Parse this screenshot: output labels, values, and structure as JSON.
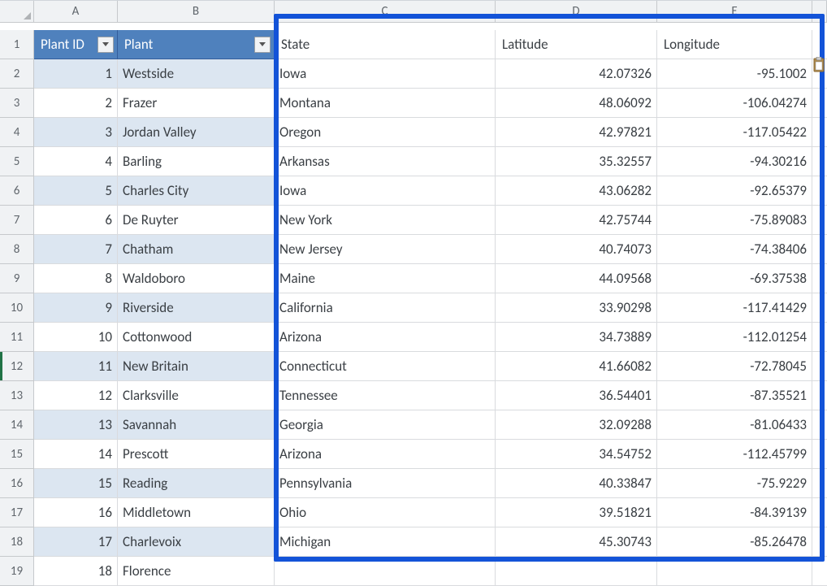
{
  "columns": {
    "A": "A",
    "B": "B",
    "C": "C",
    "D": "D",
    "E": "E"
  },
  "table_headers": {
    "plant_id": "Plant ID",
    "plant": "Plant"
  },
  "plain_headers": {
    "state": "State",
    "latitude": "Latitude",
    "longitude": "Longitude"
  },
  "rows": [
    {
      "n": "1"
    },
    {
      "n": "2",
      "id": "1",
      "plant": "Westside",
      "state": "Iowa",
      "lat": "42.07326",
      "lon": "-95.1002"
    },
    {
      "n": "3",
      "id": "2",
      "plant": "Frazer",
      "state": "Montana",
      "lat": "48.06092",
      "lon": "-106.04274"
    },
    {
      "n": "4",
      "id": "3",
      "plant": "Jordan Valley",
      "state": "Oregon",
      "lat": "42.97821",
      "lon": "-117.05422"
    },
    {
      "n": "5",
      "id": "4",
      "plant": "Barling",
      "state": "Arkansas",
      "lat": "35.32557",
      "lon": "-94.30216"
    },
    {
      "n": "6",
      "id": "5",
      "plant": "Charles City",
      "state": "Iowa",
      "lat": "43.06282",
      "lon": "-92.65379"
    },
    {
      "n": "7",
      "id": "6",
      "plant": "De Ruyter",
      "state": "New York",
      "lat": "42.75744",
      "lon": "-75.89083"
    },
    {
      "n": "8",
      "id": "7",
      "plant": "Chatham",
      "state": "New Jersey",
      "lat": "40.74073",
      "lon": "-74.38406"
    },
    {
      "n": "9",
      "id": "8",
      "plant": "Waldoboro",
      "state": "Maine",
      "lat": "44.09568",
      "lon": "-69.37538"
    },
    {
      "n": "10",
      "id": "9",
      "plant": "Riverside",
      "state": "California",
      "lat": "33.90298",
      "lon": "-117.41429"
    },
    {
      "n": "11",
      "id": "10",
      "plant": "Cottonwood",
      "state": "Arizona",
      "lat": "34.73889",
      "lon": "-112.01254"
    },
    {
      "n": "12",
      "id": "11",
      "plant": "New Britain",
      "state": "Connecticut",
      "lat": "41.66082",
      "lon": "-72.78045"
    },
    {
      "n": "13",
      "id": "12",
      "plant": "Clarksville",
      "state": "Tennessee",
      "lat": "36.54401",
      "lon": "-87.35521"
    },
    {
      "n": "14",
      "id": "13",
      "plant": "Savannah",
      "state": "Georgia",
      "lat": "32.09288",
      "lon": "-81.06433"
    },
    {
      "n": "15",
      "id": "14",
      "plant": "Prescott",
      "state": "Arizona",
      "lat": "34.54752",
      "lon": "-112.45799"
    },
    {
      "n": "16",
      "id": "15",
      "plant": "Reading",
      "state": "Pennsylvania",
      "lat": "40.33847",
      "lon": "-75.9229"
    },
    {
      "n": "17",
      "id": "16",
      "plant": "Middletown",
      "state": "Ohio",
      "lat": "39.51821",
      "lon": "-84.39139"
    },
    {
      "n": "18",
      "id": "17",
      "plant": "Charlevoix",
      "state": "Michigan",
      "lat": "45.30743",
      "lon": "-85.26478"
    },
    {
      "n": "19",
      "id": "18",
      "plant": "Florence",
      "state": "",
      "lat": "",
      "lon": ""
    }
  ],
  "selected_row": "12"
}
